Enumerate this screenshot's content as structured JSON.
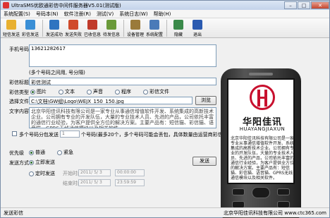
{
  "window": {
    "title": "UltraSMS优欧通彩信中间件服务器V5.01(测试版)",
    "buttons": {
      "minimize": "–",
      "maximize": "□",
      "close": "✕"
    }
  },
  "menubar": [
    "系统配置(S)",
    "号码本(N)",
    "软件注册(R)",
    "测试(V)",
    "系统日志(W)",
    "帮助(H)"
  ],
  "toolbar": [
    {
      "label": "短信发送",
      "icon": "sms-send-icon",
      "color": "#e8b030"
    },
    {
      "label": "彩信发送",
      "icon": "mms-send-icon",
      "color": "#3a8fd6"
    },
    {
      "label": "发送成功",
      "icon": "send-success-icon",
      "color": "#2f74c0"
    },
    {
      "label": "发送失败",
      "icon": "send-fail-icon",
      "color": "#d04a2a"
    },
    {
      "label": "已收信息",
      "icon": "inbox-icon",
      "color": "#c03a2a"
    },
    {
      "label": "待发信息",
      "icon": "outbox-icon",
      "color": "#6a9a3a"
    },
    {
      "label": "设备管理",
      "icon": "device-manage-icon",
      "color": "#9a7a3a"
    },
    {
      "label": "系统配置",
      "icon": "system-config-icon",
      "color": "#4a7ab8"
    },
    {
      "label": "隐藏",
      "icon": "hide-icon",
      "color": "#3a8a4a"
    },
    {
      "label": "退出",
      "icon": "exit-icon",
      "color": "#2a5ab0"
    }
  ],
  "form": {
    "phone_label": "手机号码",
    "phone_value": "13621282617",
    "phone_hint": "(多个号码之间用, 号分隔)",
    "mms_title_label": "彩信标题",
    "mms_title_value": "彩信测试",
    "mms_type_label": "彩信类型",
    "mms_types": [
      "图片",
      "文本",
      "声音",
      "程序",
      "彩信文件"
    ],
    "mms_type_selected": "图片",
    "file_label": "选择文件",
    "file_value": "C:\\文档\\GW组\\Logo\\WEJX_150_150.jpg",
    "browse_button": "浏览",
    "text_label": "文字内容",
    "text_value": "北京华阳佳讯科技有限公司是一家专业从事通信增值软件开发、系统集成的高新技术企业。公司拥有专业的开发队伍，大量的专业技术人员、先进的产品，公司依托丰富的通信行业经验，为客户提供全方位的解决方案。主要产品有：短信猫、彩信猫、语音猫、GPRS无线通信模块以及相关软件。",
    "split_checkbox_label": "多个号码分包发送",
    "split_count": "1",
    "split_hint": "个号码(最多20个，多个号码可能会丢包，具体数量由运营商彩信网关决定)",
    "priority_label": "优先级",
    "priorities": [
      "普通",
      "紧急"
    ],
    "priority_selected": "普通",
    "send_mode_label": "发送方式",
    "send_modes": [
      "立即发送",
      "定时发送"
    ],
    "send_mode_selected": "立即发送",
    "send_button": "发送",
    "start_time_label": "开始时间",
    "start_date": "2011/ 5/ 3",
    "start_time": "00:00:00",
    "end_time_label": "结束时间",
    "end_date": "2011/ 5/ 3",
    "end_time": "23:59:59"
  },
  "phone_preview": {
    "brand_cn": "华阳佳讯",
    "brand_en": "HUAYANGJIAXUN",
    "text": "北京华阳佳讯科技有限公司是一家专业从事通信增值软件开发、系统集成的高新技术企业。公司拥有专业的开发队伍，大量的专业技术人员、先进的产品，公司依托丰富的通信行业经验，为客户提供全方位的解决方案。主要产品有：短信猫、彩信猫、语音猫、GPRS无线通信模块以及相关软件。"
  },
  "statusbar": {
    "left": "发送彩信",
    "right": "北京华阳佳讯科技有限公司 www.ctc365.com"
  }
}
